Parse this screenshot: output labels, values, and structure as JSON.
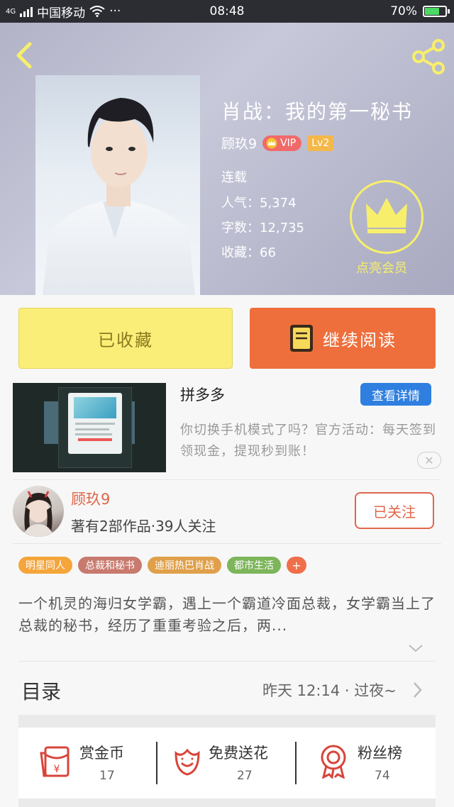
{
  "status_bar": {
    "carrier_label": "4G",
    "carrier": "中国移动",
    "more": "···",
    "time": "08:48",
    "battery": "70%",
    "battery_level": 0.7
  },
  "book": {
    "title": "肖战：我的第一秘书",
    "author": "顾玖9",
    "vip_label": "VIP",
    "level": "Lv2",
    "status": "连载",
    "popularity": "人气：5,374",
    "word_count": "字数：12,735",
    "favorites": "收藏：66",
    "membership_label": "点亮会员"
  },
  "actions": {
    "favorited_label": "已收藏",
    "continue_label": "继续阅读"
  },
  "ad": {
    "title": "拼多多",
    "detail_button": "查看详情",
    "description": "你切换手机模式了吗？官方活动：每天签到领现金，提现秒到账！",
    "close_symbol": "✕"
  },
  "author_card": {
    "name": "顾玖9",
    "stats": "著有2部作品·39人关注",
    "follow_label": "已关注"
  },
  "tags": [
    {
      "label": "明星同人",
      "color": "#f5a53a"
    },
    {
      "label": "总裁和秘书",
      "color": "#c87a6e"
    },
    {
      "label": "迪丽热巴肖战",
      "color": "#e0a04a"
    },
    {
      "label": "都市生活",
      "color": "#7cb55a"
    },
    {
      "label": "+",
      "color": "#ef6f4a"
    }
  ],
  "synopsis": "一个机灵的海归女学霸，遇上一个霸道冷面总裁，女学霸当上了总裁的秘书，经历了重重考验之后，两...",
  "toc": {
    "title": "目录",
    "update": "昨天 12:14 · 过夜~"
  },
  "bottom_bar": {
    "items": [
      {
        "label": "赏金币",
        "count": "17"
      },
      {
        "label": "免费送花",
        "count": "27"
      },
      {
        "label": "粉丝榜",
        "count": "74"
      }
    ]
  },
  "colors": {
    "accent_orange": "#ee6f3c",
    "accent_yellow": "#fbee78",
    "author_red": "#e0664a",
    "detail_blue": "#2f7fe0"
  }
}
